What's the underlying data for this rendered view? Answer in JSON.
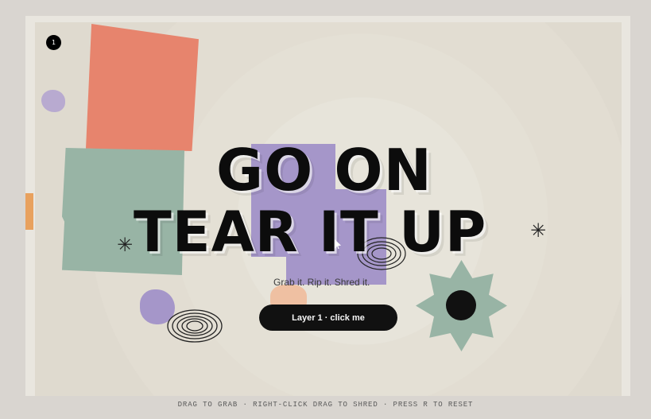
{
  "stage": {
    "badge": "1"
  },
  "hero": {
    "line1": "GO ON",
    "line2": "TEAR IT UP",
    "subtitle": "Grab it. Rip it. Shred it.",
    "button_label": "Layer 1 · click me"
  },
  "decor": {
    "asterisk": "✳"
  },
  "footer": {
    "text": "DRAG TO GRAB · RIGHT-CLICK DRAG TO SHRED · PRESS R TO RESET"
  },
  "colors": {
    "background": "#d9d5d0",
    "salmon": "#e7846d",
    "green": "#98b4a5",
    "purple": "#a596c9",
    "peach": "#efc0a2",
    "orange": "#e8a15e",
    "ink": "#0c0c0c"
  },
  "icons": {
    "badge": "layer-badge-icon",
    "cursor": "cursor-arrow-icon",
    "asterisk": "asterisk-icon",
    "scribble": "scribble-icon"
  }
}
